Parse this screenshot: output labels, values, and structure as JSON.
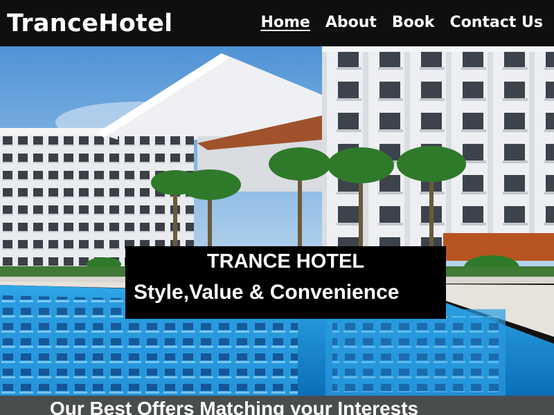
{
  "header": {
    "brand": "TranceHotel",
    "nav": [
      {
        "label": "Home",
        "active": true
      },
      {
        "label": "About",
        "active": false
      },
      {
        "label": "Book",
        "active": false
      },
      {
        "label": "Contact Us",
        "active": false
      }
    ]
  },
  "hero": {
    "title": "TRANCE HOTEL",
    "subtitle": "Style,Value & Convenience"
  },
  "offers": {
    "heading": "Our Best Offers Matching your Interests"
  },
  "colors": {
    "header_bg": "#0f0f0f",
    "sky": "#5c9bd8",
    "pool": "#1a8fd6",
    "banner_bg": "#000000"
  }
}
